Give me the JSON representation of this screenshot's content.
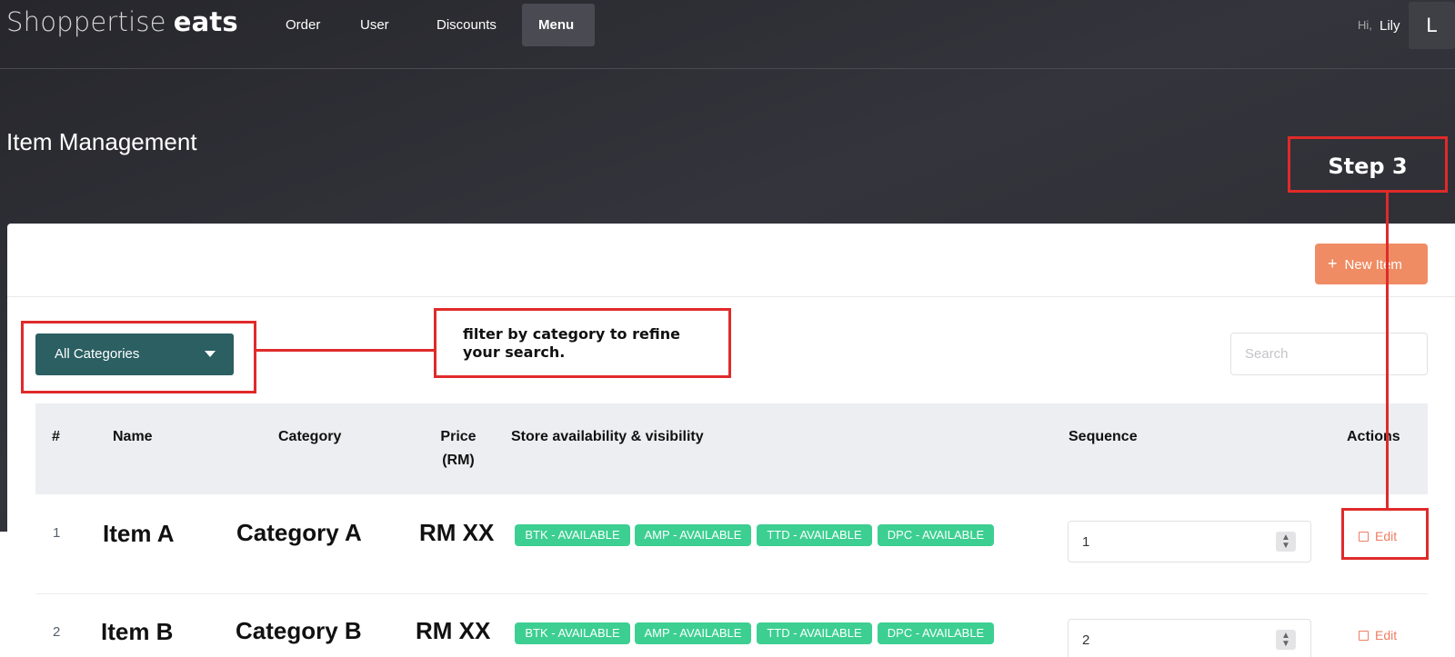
{
  "brand": {
    "part1": "Shoppertise",
    "part2": "eats"
  },
  "nav": [
    {
      "label": "Order"
    },
    {
      "label": "User"
    },
    {
      "label": "Discounts"
    },
    {
      "label": "Menu",
      "active": true
    }
  ],
  "user": {
    "greeting": "Hi,",
    "name": "Lily",
    "initial": "L"
  },
  "page": {
    "title": "Item Management"
  },
  "toolbar": {
    "new_item_label": "New Item",
    "new_item_icon": "plus-icon"
  },
  "filters": {
    "category_selected": "All Categories",
    "search_placeholder": "Search"
  },
  "table": {
    "columns": [
      "#",
      "Name",
      "Category",
      "Price",
      "(RM)",
      "Store availability & visibility",
      "Sequence",
      "Actions"
    ],
    "rows": [
      {
        "index": "1",
        "name": "Item A",
        "category": "Category A",
        "price": "RM XX",
        "badges": [
          "BTK - AVAILABLE",
          "AMP - AVAILABLE",
          "TTD - AVAILABLE",
          "DPC - AVAILABLE"
        ],
        "sequence": "1",
        "action": "Edit"
      },
      {
        "index": "2",
        "name": "Item B",
        "category": "Category B",
        "price": "RM XX",
        "badges": [
          "BTK - AVAILABLE",
          "AMP - AVAILABLE",
          "TTD - AVAILABLE",
          "DPC - AVAILABLE"
        ],
        "sequence": "2",
        "action": "Edit"
      }
    ]
  },
  "annotations": {
    "filter_note": "filter by category to refine your search.",
    "step_label": "Step 3"
  },
  "colors": {
    "header_bg": "#2e2e35",
    "accent_orange": "#ef8c64",
    "select_teal": "#2b5f62",
    "badge_green": "#3ccf91",
    "annotation_red": "#e02a2a"
  }
}
